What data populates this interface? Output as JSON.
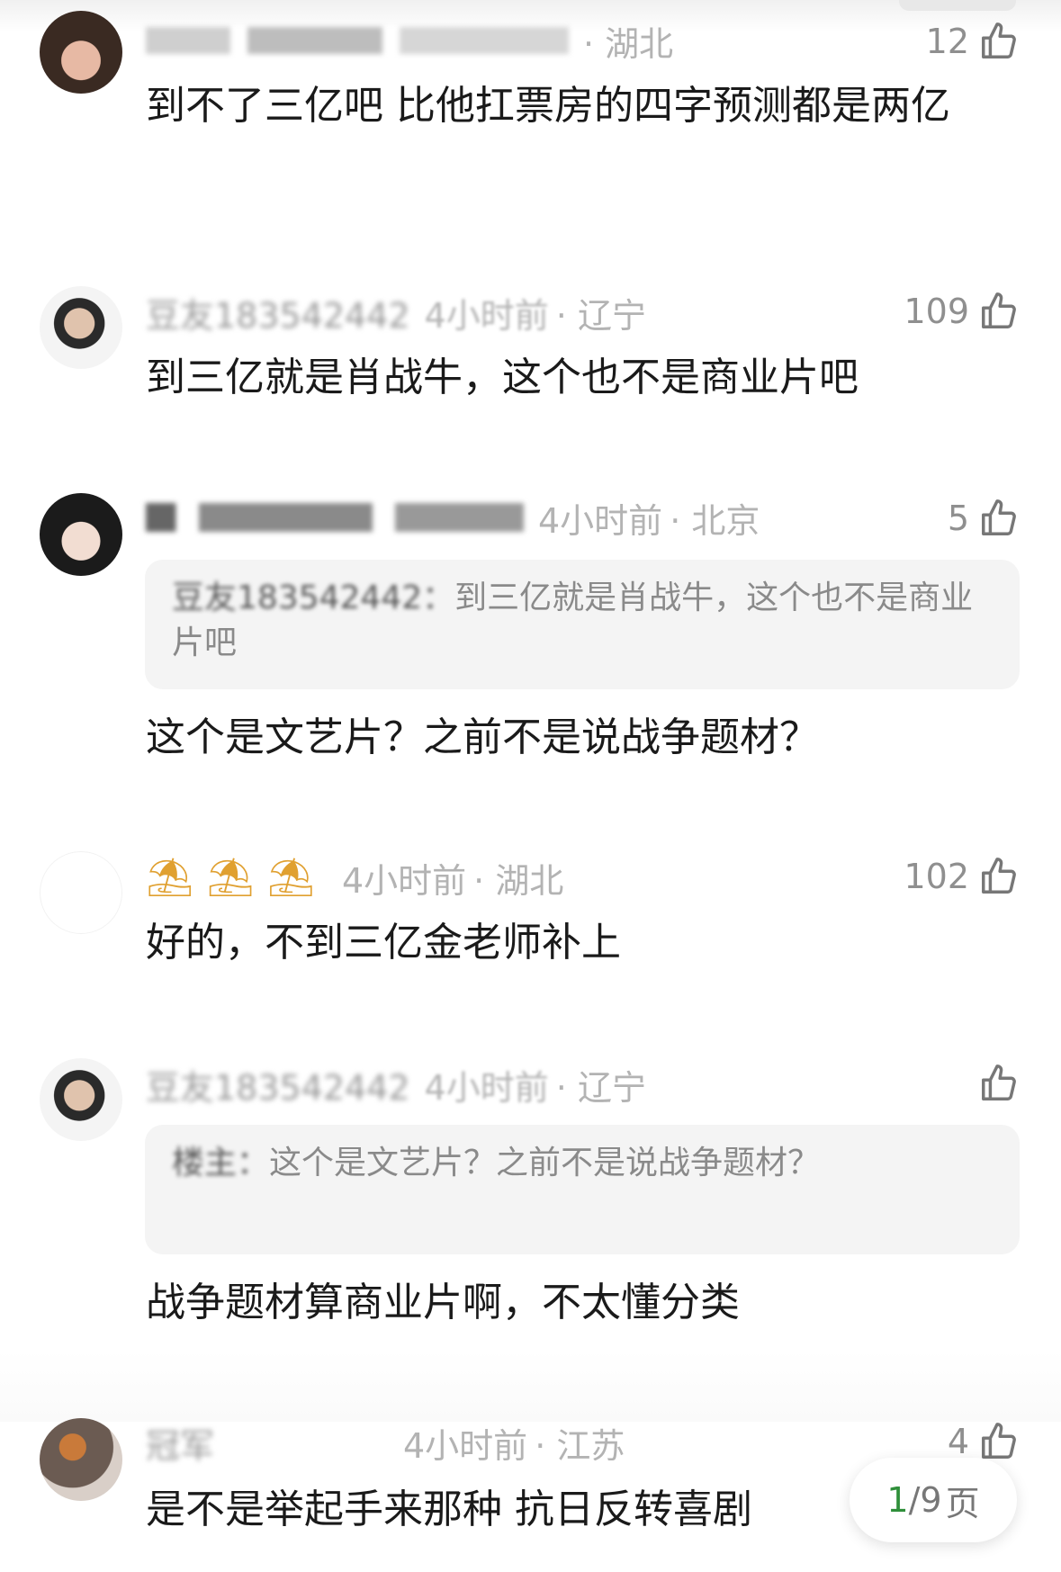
{
  "comments": [
    {
      "username": "",
      "time": "",
      "location": "· 湖北",
      "likes": "12",
      "text": "到不了三亿吧 比他扛票房的四字预测都是两亿"
    },
    {
      "username": "豆友183542442",
      "time": "4小时前",
      "location": "· 辽宁",
      "likes": "109",
      "text": "到三亿就是肖战牛，这个也不是商业片吧"
    },
    {
      "username": "",
      "time": "4小时前",
      "location": "· 北京",
      "likes": "5",
      "quote_name": "豆友183542442：",
      "quote_text": "到三亿就是肖战牛，这个也不是商业片吧",
      "text": "这个是文艺片？之前不是说战争题材？"
    },
    {
      "username": "⛱⛱⛱",
      "time": "4小时前",
      "location": "· 湖北",
      "likes": "102",
      "text": "好的，不到三亿金老师补上"
    },
    {
      "username": "豆友183542442",
      "time": "4小时前",
      "location": "· 辽宁",
      "likes": "",
      "quote_name": "楼主：",
      "quote_text": "这个是文艺片？之前不是说战争题材？",
      "text": "战争题材算商业片啊，不太懂分类"
    },
    {
      "username": "冠军",
      "time": "4小时前",
      "location": "· 江苏",
      "likes": "4",
      "text": "是不是举起手来那种 抗日反转喜剧"
    }
  ],
  "pager": {
    "current": "1",
    "total": "/9",
    "unit": "页"
  },
  "icons": {
    "like": "thumbs-up-icon"
  },
  "colors": {
    "accent": "#2f8f3a",
    "meta": "#b3b3b3",
    "quote_bg": "#f4f4f4"
  }
}
